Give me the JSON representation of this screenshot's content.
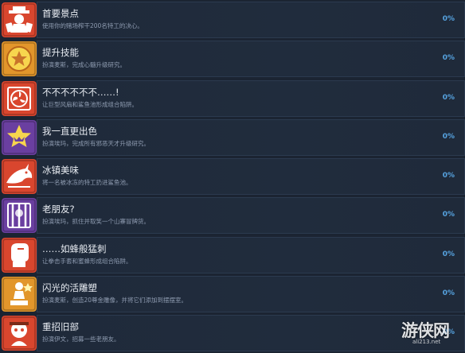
{
  "achievements": [
    {
      "title": "首要景点",
      "description": "使用你的赌场榨干200名特工的决心。",
      "percent": "0%",
      "icon": "gangster-cards-icon",
      "bg": "#d9462e",
      "fg": "#ffffff"
    },
    {
      "title": "提升技能",
      "description": "扮演麦斯，完成心髓升级研究。",
      "percent": "0%",
      "icon": "gold-star-badge-icon",
      "bg": "#e2962b",
      "fg": "#f7d54e"
    },
    {
      "title": "不不不不不不……!",
      "description": "让巨型风扇和鲨鱼池形成组合陷阱。",
      "percent": "0%",
      "icon": "fan-trap-icon",
      "bg": "#d9462e",
      "fg": "#ffffff"
    },
    {
      "title": "我一直更出色",
      "description": "扮演埃玛，完成所有邪恶天才升级研究。",
      "percent": "0%",
      "icon": "star-villain-icon",
      "bg": "#6a3fa0",
      "fg": "#f7d54e"
    },
    {
      "title": "冰镇美味",
      "description": "将一名被冰冻的特工扔进鲨鱼池。",
      "percent": "0%",
      "icon": "shark-icon",
      "bg": "#d9462e",
      "fg": "#ffffff"
    },
    {
      "title": "老朋友?",
      "description": "扮演埃玛，抓住并取笑一个山寨冒牌货。",
      "percent": "0%",
      "icon": "jail-bars-icon",
      "bg": "#6a3fa0",
      "fg": "#ffffff"
    },
    {
      "title": "……如蜂般猛刺",
      "description": "让拳击手套和蜜蜂形成组合陷阱。",
      "percent": "0%",
      "icon": "boxing-glove-icon",
      "bg": "#d9462e",
      "fg": "#ffffff"
    },
    {
      "title": "闪光的活雕塑",
      "description": "扮演麦斯，创造20尊金雕像，并将它们添加到摆摆室。",
      "percent": "0%",
      "icon": "golden-statue-icon",
      "bg": "#e2962b",
      "fg": "#ffffff"
    },
    {
      "title": "重招旧部",
      "description": "扮演伊文，招募一些老朋友。",
      "percent": "0%",
      "icon": "old-friends-icon",
      "bg": "#d9462e",
      "fg": "#ffffff"
    }
  ],
  "watermark": {
    "text": "游侠网",
    "url": "ali213.net"
  }
}
